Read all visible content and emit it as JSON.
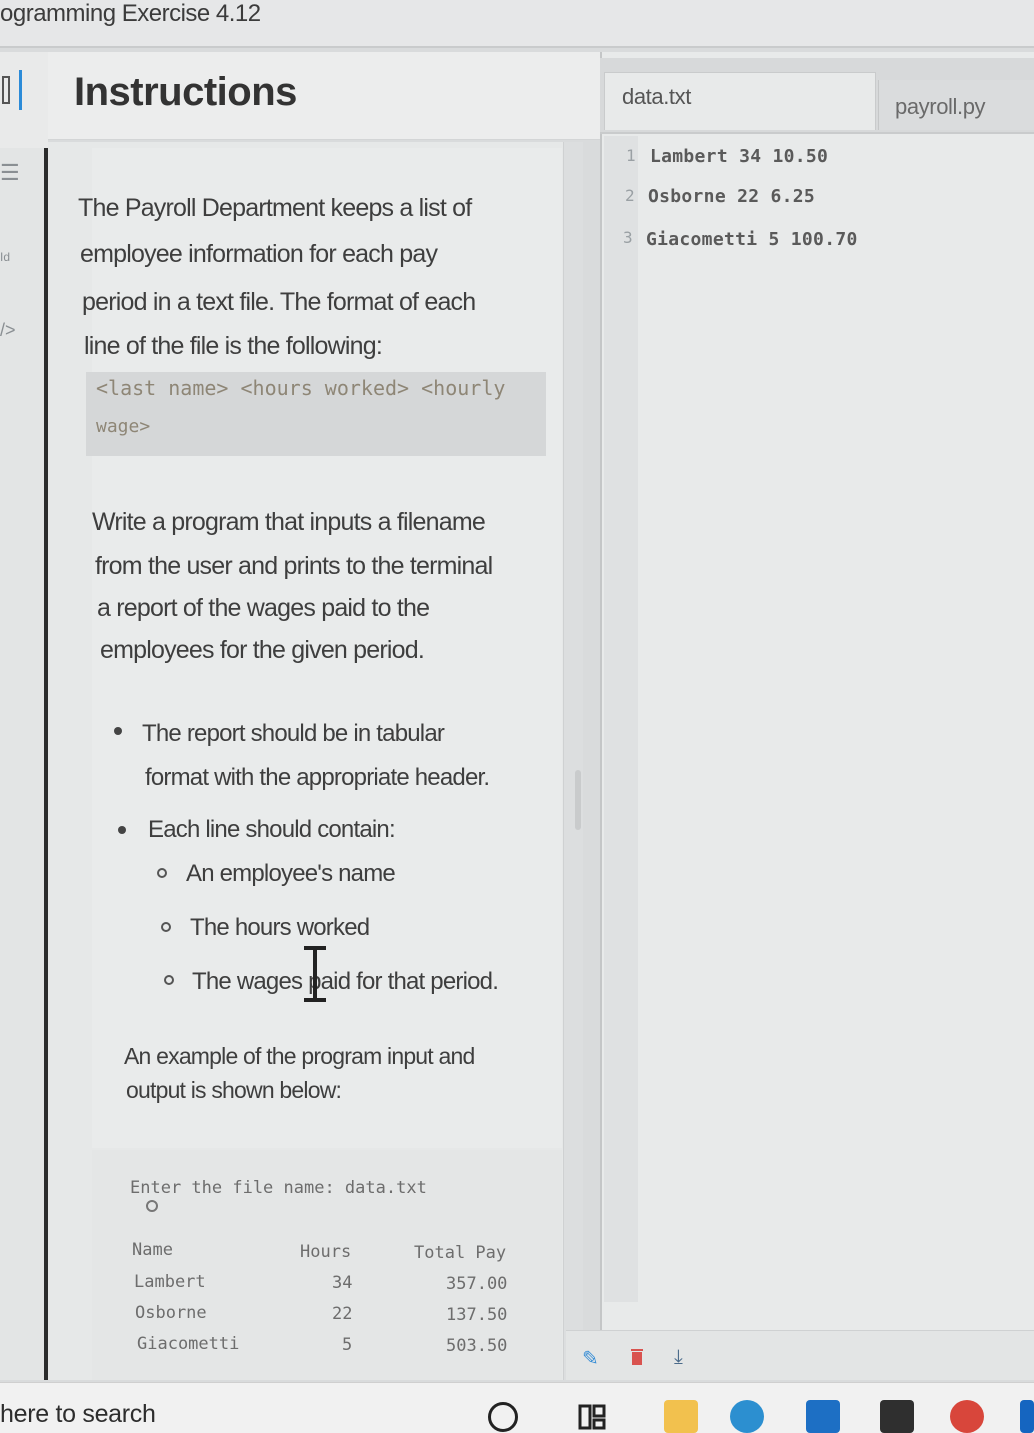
{
  "window": {
    "title": "ogramming Exercise 4.12"
  },
  "instructions": {
    "title": "Instructions",
    "para1": [
      "The Payroll Department keeps a list of",
      "employee information for each pay",
      "period in a text file. The format of each",
      "line of the file is the following:"
    ],
    "format_code": [
      "<last name> <hours worked> <hourly",
      "wage>"
    ],
    "para2": [
      "Write a program that inputs a filename",
      "from the user and prints to the terminal",
      "a report of the wages paid to the",
      "employees for the given period."
    ],
    "bullets": [
      [
        "The report should be in tabular",
        "format with the appropriate header."
      ],
      [
        "Each line should contain:"
      ]
    ],
    "sub_bullets": [
      "An employee's name",
      "The hours worked",
      "The wages paid for that period."
    ],
    "example_intro": [
      "An example of the program input and",
      "output is shown below:"
    ],
    "terminal": {
      "prompt": "Enter the file name: data.txt",
      "headers": [
        "Name",
        "Hours",
        "Total Pay"
      ],
      "rows": [
        [
          "Lambert",
          "34",
          "357.00"
        ],
        [
          "Osborne",
          "22",
          "137.50"
        ],
        [
          "Giacometti",
          "5",
          "503.50"
        ]
      ]
    }
  },
  "editor": {
    "tabs": [
      {
        "label": "data.txt",
        "active": true
      },
      {
        "label": "payroll.py",
        "active": false
      }
    ],
    "line_numbers": [
      "1",
      "2",
      "3"
    ],
    "lines": [
      "Lambert 34 10.50",
      "Osborne 22 6.25",
      "Giacometti 5 100.70"
    ],
    "toolbar_icons": [
      "pencil-icon",
      "trash-icon",
      "download-icon"
    ]
  },
  "taskbar": {
    "search_text": "here to search",
    "icons": [
      "cortana-icon",
      "task-view-icon",
      "file-explorer-icon",
      "edge-icon",
      "mail-icon",
      "store-icon",
      "chrome-icon"
    ]
  },
  "colors": {
    "accent_blue": "#2b8bd8",
    "trash_red": "#d9534f",
    "pencil_blue": "#3a8fd6"
  }
}
